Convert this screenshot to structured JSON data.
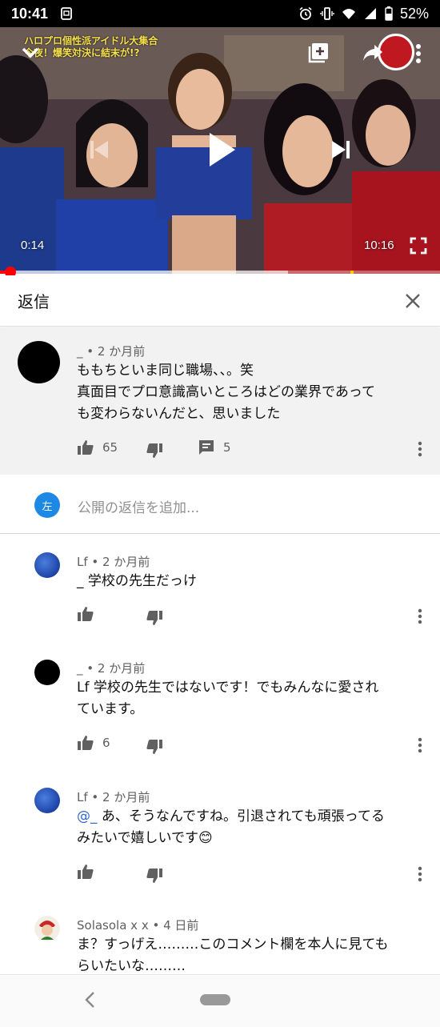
{
  "status_bar": {
    "time": "10:41",
    "battery": "52%"
  },
  "video": {
    "current_time": "0:14",
    "duration": "10:16",
    "progress_fraction": 0.023,
    "overlay_caption_line1": "ハロプロ個性派アイドル大集合",
    "overlay_caption_line2": "今夜！爆笑対決に結末が!?"
  },
  "replies_panel": {
    "title": "返信"
  },
  "parent_comment": {
    "author": "_",
    "time": "2 か月前",
    "text_lines": [
      "ももちといま同じ職場、、。笑",
      "真面目でプロ意識高いところはどの業界であって",
      "も変わらないんだと、思いました"
    ],
    "likes": "65",
    "replies": "5"
  },
  "add_reply": {
    "avatar_letter": "左",
    "placeholder": "公開の返信を追加..."
  },
  "replies": [
    {
      "author": "Lf",
      "time": "2 か月前",
      "lines": [
        "_ 学校の先生だっけ"
      ],
      "likes": ""
    },
    {
      "author": "_",
      "time": "2 か月前",
      "lines": [
        "Lf 学校の先生ではないです！でもみんなに愛され",
        "ています。"
      ],
      "likes": "6"
    },
    {
      "author": "Lf",
      "time": "2 か月前",
      "mention": "@_",
      "lines": [
        " あ、そうなんですね。引退されても頑張ってる",
        "みたいで嬉しいです😊"
      ],
      "likes": ""
    },
    {
      "author": "Solasola x x",
      "time": "4 日前",
      "lines": [
        "ま？すっげえ………このコメント欄を本人に見ても",
        "らいたいな………"
      ],
      "likes": ""
    }
  ],
  "colors": {
    "accent_red": "#ff0000",
    "mention_blue": "#3166cc",
    "self_avatar": "#1e88e5"
  }
}
